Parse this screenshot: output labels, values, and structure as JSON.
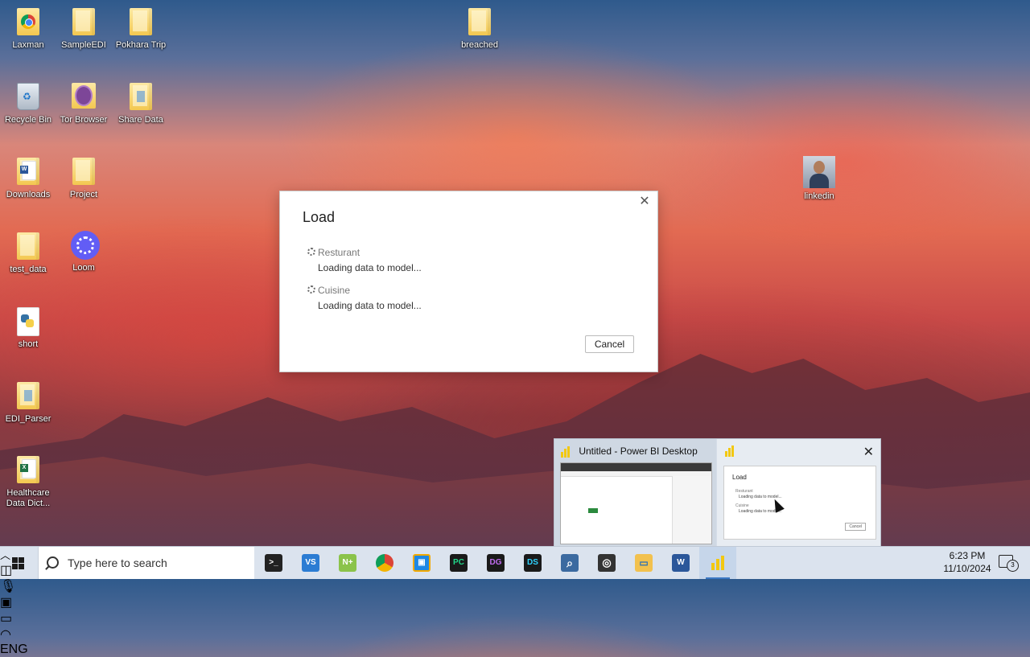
{
  "desktop": {
    "icons": [
      {
        "label": "Laxman",
        "icon": "chrome-icon"
      },
      {
        "label": "SampleEDI",
        "icon": "folder-icon"
      },
      {
        "label": "Pokhara Trip",
        "icon": "folder-icon"
      },
      {
        "label": "breached",
        "icon": "folder-icon"
      },
      {
        "label": "Recycle Bin",
        "icon": "recycle-bin-icon"
      },
      {
        "label": "Tor Browser",
        "icon": "tor-browser-icon"
      },
      {
        "label": "Share Data",
        "icon": "document-icon"
      },
      {
        "label": "Downloads",
        "icon": "word-document-icon"
      },
      {
        "label": "Project",
        "icon": "folder-icon"
      },
      {
        "label": "linkedin",
        "icon": "profile-photo-icon"
      },
      {
        "label": "test_data",
        "icon": "folder-icon"
      },
      {
        "label": "Loom",
        "icon": "loom-icon"
      },
      {
        "label": "short",
        "icon": "python-file-icon"
      },
      {
        "label": "EDI_Parser",
        "icon": "document-icon"
      },
      {
        "label": "Healthcare Data Dict...",
        "icon": "excel-document-icon"
      }
    ]
  },
  "dialog": {
    "title": "Load",
    "items": [
      {
        "name": "Resturant",
        "status": "Loading data to model..."
      },
      {
        "name": "Cuisine",
        "status": "Loading data to model..."
      }
    ],
    "cancel_label": "Cancel",
    "close_glyph": "✕"
  },
  "preview": {
    "title": "Untitled - Power BI Desktop",
    "close_glyph": "✕",
    "mini_dialog": {
      "title": "Load",
      "items": [
        {
          "name": "Resturant",
          "status": "Loading data to model..."
        },
        {
          "name": "Cuisine",
          "status": "Loading data to model..."
        }
      ],
      "cancel_label": "Cancel"
    }
  },
  "taskbar": {
    "search_placeholder": "Type here to search",
    "apps": [
      {
        "name": "terminal",
        "glyph": ">_",
        "color": "#222222"
      },
      {
        "name": "vscode",
        "glyph": "VS",
        "color": "#2b7cd3"
      },
      {
        "name": "notepad-plus",
        "glyph": "N+",
        "color": "#8bc34a"
      },
      {
        "name": "chrome",
        "glyph": "●",
        "color": "#db4437"
      },
      {
        "name": "app-orange",
        "glyph": "▣",
        "color": "#1e88e5"
      },
      {
        "name": "pycharm",
        "glyph": "PC",
        "color": "#1a1a1a"
      },
      {
        "name": "datagrip",
        "glyph": "DG",
        "color": "#5a2d82"
      },
      {
        "name": "dataspell",
        "glyph": "DS",
        "color": "#1a1a1a"
      },
      {
        "name": "search-app",
        "glyph": "⌕",
        "color": "#3b6aa0"
      },
      {
        "name": "davinci",
        "glyph": "◎",
        "color": "#333333"
      },
      {
        "name": "file-explorer",
        "glyph": "▭",
        "color": "#f2c14e"
      },
      {
        "name": "word",
        "glyph": "W",
        "color": "#2b579a"
      },
      {
        "name": "power-bi",
        "glyph": "",
        "color": "#f2c811"
      }
    ],
    "language": "ENG",
    "time": "6:23 PM",
    "date": "11/10/2024",
    "notification_count": "3"
  }
}
